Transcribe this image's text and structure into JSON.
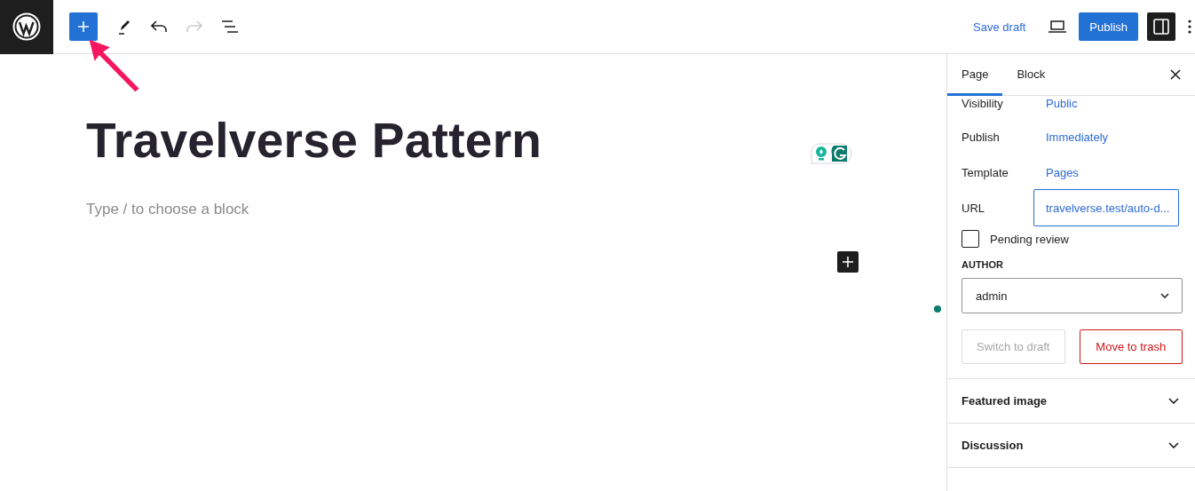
{
  "toolbar": {
    "tools": [
      {
        "kind": "pen",
        "disabled": false
      },
      {
        "kind": "undo",
        "disabled": false
      },
      {
        "kind": "redo",
        "disabled": true
      },
      {
        "kind": "list",
        "disabled": false
      }
    ],
    "save_draft": "Save draft",
    "publish": "Publish",
    "settings_pressed": true
  },
  "editor": {
    "title": "Travelverse Pattern",
    "placeholder": "Type / to choose a block"
  },
  "sidebar": {
    "tabs": [
      {
        "label": "Page",
        "selected": true
      },
      {
        "label": "Block",
        "selected": false
      }
    ],
    "rows": [
      {
        "label": "Visibility",
        "value": "Public",
        "kind": "link"
      },
      {
        "label": "Publish",
        "value": "Immediately",
        "kind": "link"
      },
      {
        "label": "Template",
        "value": "Pages",
        "kind": "link"
      },
      {
        "label": "URL",
        "value": "travelverse.test/auto-d...",
        "kind": "field"
      }
    ],
    "pending_review": {
      "label": "Pending review",
      "checked": false
    },
    "author": {
      "label": "AUTHOR",
      "value": "admin"
    },
    "buttons": [
      {
        "label": "Switch to draft",
        "kind": "secondary"
      },
      {
        "label": "Move to trash",
        "kind": "destructive"
      }
    ],
    "sections": [
      {
        "title": "Featured image",
        "expanded": false
      },
      {
        "title": "Discussion",
        "expanded": false
      }
    ]
  }
}
